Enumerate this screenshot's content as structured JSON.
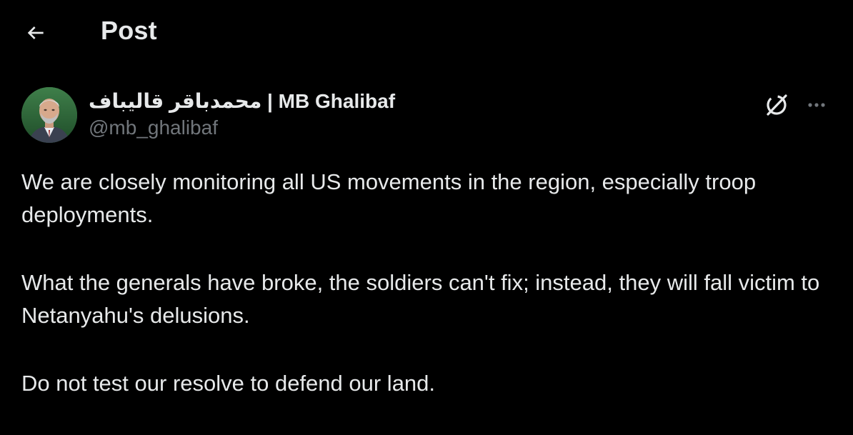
{
  "header": {
    "back_icon": "arrow-left-icon",
    "title": "Post"
  },
  "author": {
    "display_name": "محمدباقر قالیباف | MB Ghalibaf",
    "handle": "@mb_ghalibaf",
    "avatar_icon": "profile-photo"
  },
  "actions": {
    "grok_icon": "grok-icon",
    "more_icon": "more-horizontal-icon"
  },
  "tweet": {
    "paragraphs": [
      "We are closely monitoring all US movements in the region, especially troop deployments.",
      "What the generals have broke, the soldiers can't fix; instead, they will fall victim to Netanyahu's delusions.",
      "Do not test our resolve to defend our land."
    ]
  },
  "colors": {
    "background": "#000000",
    "primary_text": "#e7e9ea",
    "secondary_text": "#71767b"
  }
}
